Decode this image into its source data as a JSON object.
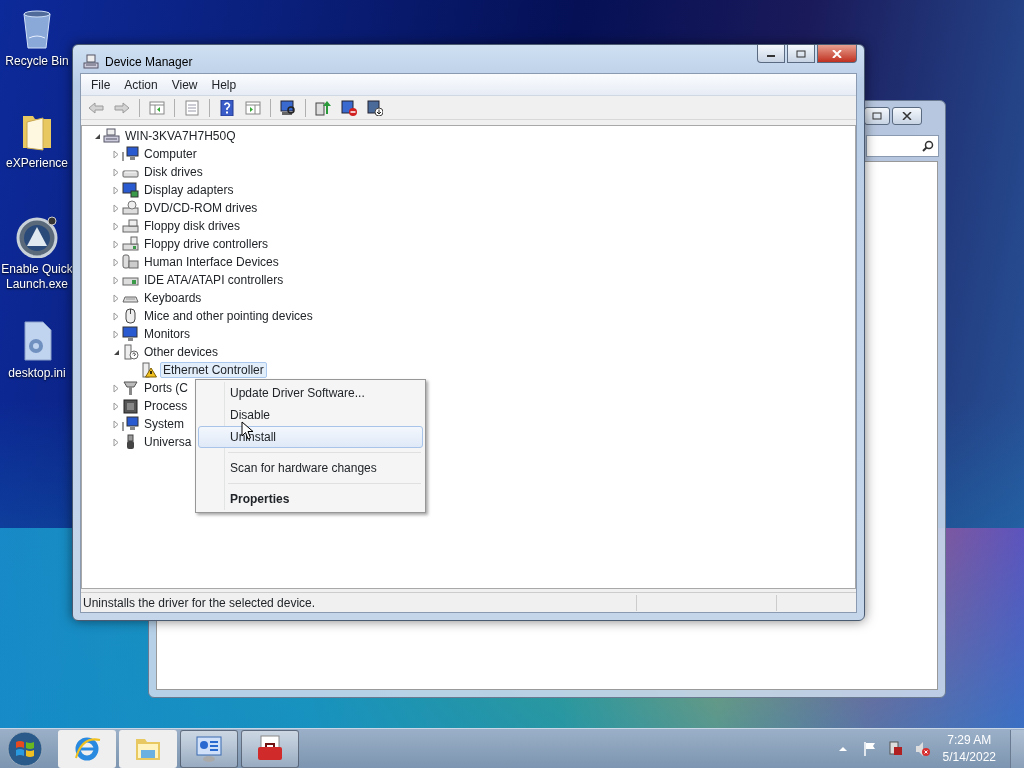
{
  "desktop_icons": [
    {
      "label": "Recycle Bin"
    },
    {
      "label": "eXPerience"
    },
    {
      "label": "Enable Quick Launch.exe"
    },
    {
      "label": "desktop.ini"
    }
  ],
  "window": {
    "title": "Device Manager",
    "menu": [
      "File",
      "Action",
      "View",
      "Help"
    ],
    "toolbar": [
      {
        "kind": "back",
        "disabled": true
      },
      {
        "kind": "forward",
        "disabled": true
      },
      {
        "kind": "sep"
      },
      {
        "kind": "tree",
        "disabled": false
      },
      {
        "kind": "sep"
      },
      {
        "kind": "props",
        "disabled": false
      },
      {
        "kind": "sep"
      },
      {
        "kind": "help",
        "disabled": false
      },
      {
        "kind": "pane",
        "disabled": false
      },
      {
        "kind": "sep"
      },
      {
        "kind": "scan",
        "disabled": false
      },
      {
        "kind": "sep"
      },
      {
        "kind": "update",
        "disabled": false
      },
      {
        "kind": "disable",
        "disabled": false
      },
      {
        "kind": "uninstall",
        "disabled": false
      }
    ],
    "tree": {
      "label": "WIN-3KVA7H7H50Q",
      "expanded": true,
      "selected": false,
      "children": [
        {
          "label": "Computer",
          "expanded": false,
          "selected": false
        },
        {
          "label": "Disk drives",
          "expanded": false,
          "selected": false
        },
        {
          "label": "Display adapters",
          "expanded": false,
          "selected": false
        },
        {
          "label": "DVD/CD-ROM drives",
          "expanded": false,
          "selected": false
        },
        {
          "label": "Floppy disk drives",
          "expanded": false,
          "selected": false
        },
        {
          "label": "Floppy drive controllers",
          "expanded": false,
          "selected": false
        },
        {
          "label": "Human Interface Devices",
          "expanded": false,
          "selected": false
        },
        {
          "label": "IDE ATA/ATAPI controllers",
          "expanded": false,
          "selected": false
        },
        {
          "label": "Keyboards",
          "expanded": false,
          "selected": false
        },
        {
          "label": "Mice and other pointing devices",
          "expanded": false,
          "selected": false
        },
        {
          "label": "Monitors",
          "expanded": false,
          "selected": false
        },
        {
          "label": "Other devices",
          "expanded": true,
          "selected": false,
          "children": [
            {
              "label": "Ethernet Controller",
              "selected": true
            }
          ]
        },
        {
          "label": "Ports (C",
          "expanded": false,
          "selected": false
        },
        {
          "label": "Process",
          "expanded": false,
          "selected": false
        },
        {
          "label": "System",
          "expanded": false,
          "selected": false
        },
        {
          "label": "Universa",
          "expanded": false,
          "selected": false
        }
      ]
    },
    "status_bar": "Uninstalls the driver for the selected device."
  },
  "context_menu": [
    {
      "kind": "item",
      "label": "Update Driver Software...",
      "selected": false,
      "default": false
    },
    {
      "kind": "item",
      "label": "Disable",
      "selected": false,
      "default": false
    },
    {
      "kind": "item",
      "label": "Uninstall",
      "selected": true,
      "default": false
    },
    {
      "kind": "separator"
    },
    {
      "kind": "item",
      "label": "Scan for hardware changes",
      "selected": false,
      "default": false
    },
    {
      "kind": "separator"
    },
    {
      "kind": "item",
      "label": "Properties",
      "selected": false,
      "default": true
    }
  ],
  "taskbar": {
    "apps": [
      {
        "kind": "ie",
        "open": false
      },
      {
        "kind": "explorer",
        "open": false
      },
      {
        "kind": "control",
        "open": true
      },
      {
        "kind": "toolbox",
        "open": true
      }
    ],
    "time": "7:29 AM",
    "date": "5/14/2022"
  }
}
